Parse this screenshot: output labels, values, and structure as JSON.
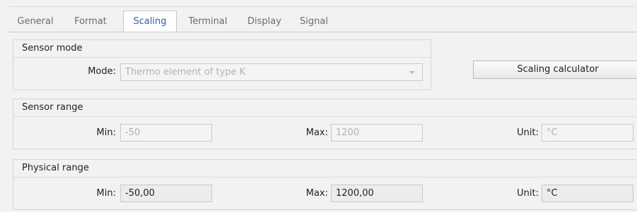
{
  "tabs": [
    {
      "label": "General"
    },
    {
      "label": "Format"
    },
    {
      "label": "Scaling"
    },
    {
      "label": "Terminal"
    },
    {
      "label": "Display"
    },
    {
      "label": "Signal"
    }
  ],
  "active_tab": "Scaling",
  "sensor_mode": {
    "title": "Sensor mode",
    "mode_label": "Mode:",
    "mode_value": "Thermo element of type K"
  },
  "scaling_calculator_label": "Scaling calculator",
  "sensor_range": {
    "title": "Sensor range",
    "min_label": "Min:",
    "min_value": "-50",
    "max_label": "Max:",
    "max_value": "1200",
    "unit_label": "Unit:",
    "unit_value": "°C"
  },
  "physical_range": {
    "title": "Physical range",
    "min_label": "Min:",
    "min_value": "-50,00",
    "max_label": "Max:",
    "max_value": "1200,00",
    "unit_label": "Unit:",
    "unit_value": "°C"
  },
  "colors": {
    "active_tab_text": "#2b5fb0",
    "inactive_tab_text": "#6b6b6b",
    "disabled_text": "#b3b3b3",
    "panel_bg": "#f2f2f2"
  }
}
